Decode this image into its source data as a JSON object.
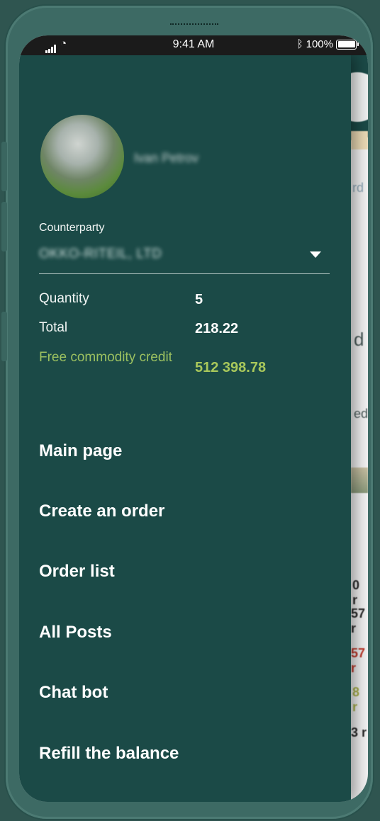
{
  "status_bar": {
    "time": "9:41 AM",
    "battery": "100%"
  },
  "drawer": {
    "user_name": "Ivan Petrov",
    "counterparty_label": "Counterparty",
    "counterparty_value": "OKKO-RITEIL, LTD",
    "stats": {
      "quantity_label": "Quantity",
      "quantity_value": "5",
      "total_label": "Total",
      "total_value": "218.22",
      "credit_label": "Free commodity credit",
      "credit_value": "512 398.78"
    },
    "menu": [
      {
        "label": "Main page"
      },
      {
        "label": "Create an order"
      },
      {
        "label": "Order list"
      },
      {
        "label": "All Posts"
      },
      {
        "label": "Chat bot"
      },
      {
        "label": "Refill the balance"
      }
    ]
  },
  "background_peek": {
    "t1": "rd",
    "t2": "d",
    "t3": "ed",
    "t4": "0 r",
    "t5": "57 r",
    "t6": "57 r",
    "t7": "8 r",
    "t8": "3 r"
  },
  "colors": {
    "drawer_bg": "#1b4a47",
    "accent_green": "#a9c85b",
    "text_white": "#ffffff"
  }
}
